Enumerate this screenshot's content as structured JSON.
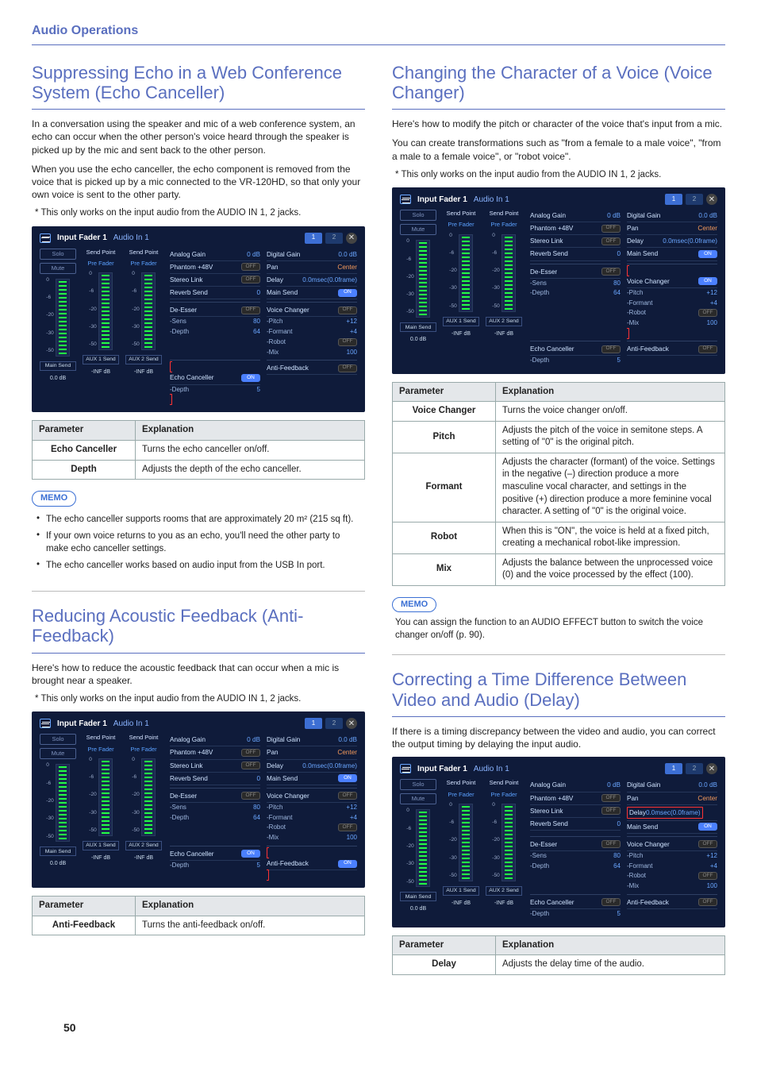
{
  "page": {
    "header": "Audio Operations",
    "number": "50"
  },
  "screenshot_common": {
    "title_prefix": "Input Fader 1",
    "source": "Audio In 1",
    "tabs": [
      "1",
      "2"
    ],
    "faders": {
      "solo": "Solo",
      "mute": "Mute",
      "send_point": "Send Point",
      "pre_fader": "Pre Fader",
      "scale": [
        "0",
        "-6",
        "-20",
        "-30",
        "-50"
      ],
      "sends": [
        {
          "label": "Main Send",
          "value": "0.0 dB"
        },
        {
          "label": "AUX 1 Send",
          "value": "-INF dB"
        },
        {
          "label": "AUX 2 Send",
          "value": "-INF dB"
        }
      ]
    },
    "params_left": [
      {
        "k": "Analog Gain",
        "v": "0 dB"
      },
      {
        "k": "Phantom +48V",
        "toggle": "OFF"
      },
      {
        "k": "Stereo Link",
        "toggle": "OFF"
      },
      {
        "k": "Reverb Send",
        "v": "0"
      }
    ],
    "params_right": [
      {
        "k": "Digital Gain",
        "v": "0.0 dB"
      },
      {
        "k": "Pan",
        "v": "Center",
        "cls": "center"
      },
      {
        "k": "Delay",
        "v": "0.0msec(0.0frame)"
      },
      {
        "k": "Main Send",
        "toggle": "ON"
      }
    ],
    "deesser": {
      "label": "De-Esser",
      "toggle": "OFF",
      "sens_k": "-Sens",
      "sens_v": "80",
      "depth_k": "-Depth",
      "depth_v": "64"
    },
    "voice_changer": {
      "label": "Voice Changer",
      "pitch_k": "-Pitch",
      "pitch_v": "+12",
      "formant_k": "-Formant",
      "formant_v": "+4",
      "robot_k": "-Robot",
      "mix_k": "-Mix",
      "mix_v": "100"
    },
    "echo_canceller": {
      "label": "Echo Canceller",
      "depth_k": "-Depth",
      "depth_v": "5"
    },
    "anti_feedback": {
      "label": "Anti-Feedback"
    }
  },
  "echo": {
    "title": "Suppressing Echo in a Web Conference System (Echo Canceller)",
    "p1": "In a conversation using the speaker and mic of a web conference system, an echo can occur when the other person's voice heard through the speaker is picked up by the mic and sent back to the other person.",
    "p2": "When you use the echo canceller, the echo component is removed from the voice that is picked up by a mic connected to the VR-120HD, so that only your own voice is sent to the other party.",
    "note": "* This only works on the input audio from the AUDIO IN 1, 2 jacks.",
    "ss": {
      "echo_state": "ON",
      "vc_state": "OFF",
      "robot_state": "OFF",
      "af_state": "OFF",
      "highlight": "echo"
    },
    "table": {
      "head": [
        "Parameter",
        "Explanation"
      ],
      "rows": [
        [
          "Echo Canceller",
          "Turns the echo canceller on/off."
        ],
        [
          "Depth",
          "Adjusts the depth of the echo canceller."
        ]
      ]
    },
    "memo_label": "MEMO",
    "memo": [
      "The echo canceller supports rooms that are approximately 20 m² (215 sq ft).",
      "If your own voice returns to you as an echo, you'll need the other party to make echo canceller settings.",
      "The echo canceller works based on audio input from the USB In port."
    ]
  },
  "anti": {
    "title": "Reducing Acoustic Feedback (Anti-Feedback)",
    "p1": "Here's how to reduce the acoustic feedback that can occur when a mic is brought near a speaker.",
    "note": "* This only works on the input audio from the AUDIO IN 1, 2 jacks.",
    "ss": {
      "echo_state": "ON",
      "vc_state": "OFF",
      "robot_state": "OFF",
      "af_state": "ON",
      "highlight": "anti"
    },
    "table": {
      "head": [
        "Parameter",
        "Explanation"
      ],
      "rows": [
        [
          "Anti-Feedback",
          "Turns the anti-feedback on/off."
        ]
      ]
    }
  },
  "voice": {
    "title": "Changing the Character of a Voice (Voice Changer)",
    "p1": "Here's how to modify the pitch or character of the voice that's input from a mic.",
    "p2": "You can create transformations such as \"from a female to a male voice\", \"from a male to a female voice\", or \"robot voice\".",
    "note": "* This only works on the input audio from the AUDIO IN 1, 2 jacks.",
    "ss": {
      "echo_state": "OFF",
      "vc_state": "ON",
      "robot_state": "OFF",
      "af_state": "OFF",
      "highlight": "voice"
    },
    "table": {
      "head": [
        "Parameter",
        "Explanation"
      ],
      "rows": [
        [
          "Voice Changer",
          "Turns the voice changer on/off."
        ],
        [
          "Pitch",
          "Adjusts the pitch of the voice in semitone steps. A setting of \"0\" is the original pitch."
        ],
        [
          "Formant",
          "Adjusts the character (formant) of the voice. Settings in the negative (–) direction produce a more masculine vocal character, and settings in the positive (+) direction produce a more feminine vocal character. A setting of \"0\" is the original voice."
        ],
        [
          "Robot",
          "When this is \"ON\", the voice is held at a fixed pitch, creating a mechanical robot-like impression."
        ],
        [
          "Mix",
          "Adjusts the balance between the unprocessed voice (0) and the voice processed by the effect (100)."
        ]
      ]
    },
    "memo_label": "MEMO",
    "memo_text": "You can assign the function to an AUDIO EFFECT button to switch the voice changer on/off (p. 90)."
  },
  "delay": {
    "title": "Correcting a Time Difference Between Video and Audio (Delay)",
    "p1": "If there is a timing discrepancy between the video and audio, you can correct the output timing by delaying the input audio.",
    "ss": {
      "echo_state": "OFF",
      "vc_state": "OFF",
      "robot_state": "OFF",
      "af_state": "OFF",
      "highlight": "delay"
    },
    "table": {
      "head": [
        "Parameter",
        "Explanation"
      ],
      "rows": [
        [
          "Delay",
          "Adjusts the delay time of the audio."
        ]
      ]
    }
  }
}
